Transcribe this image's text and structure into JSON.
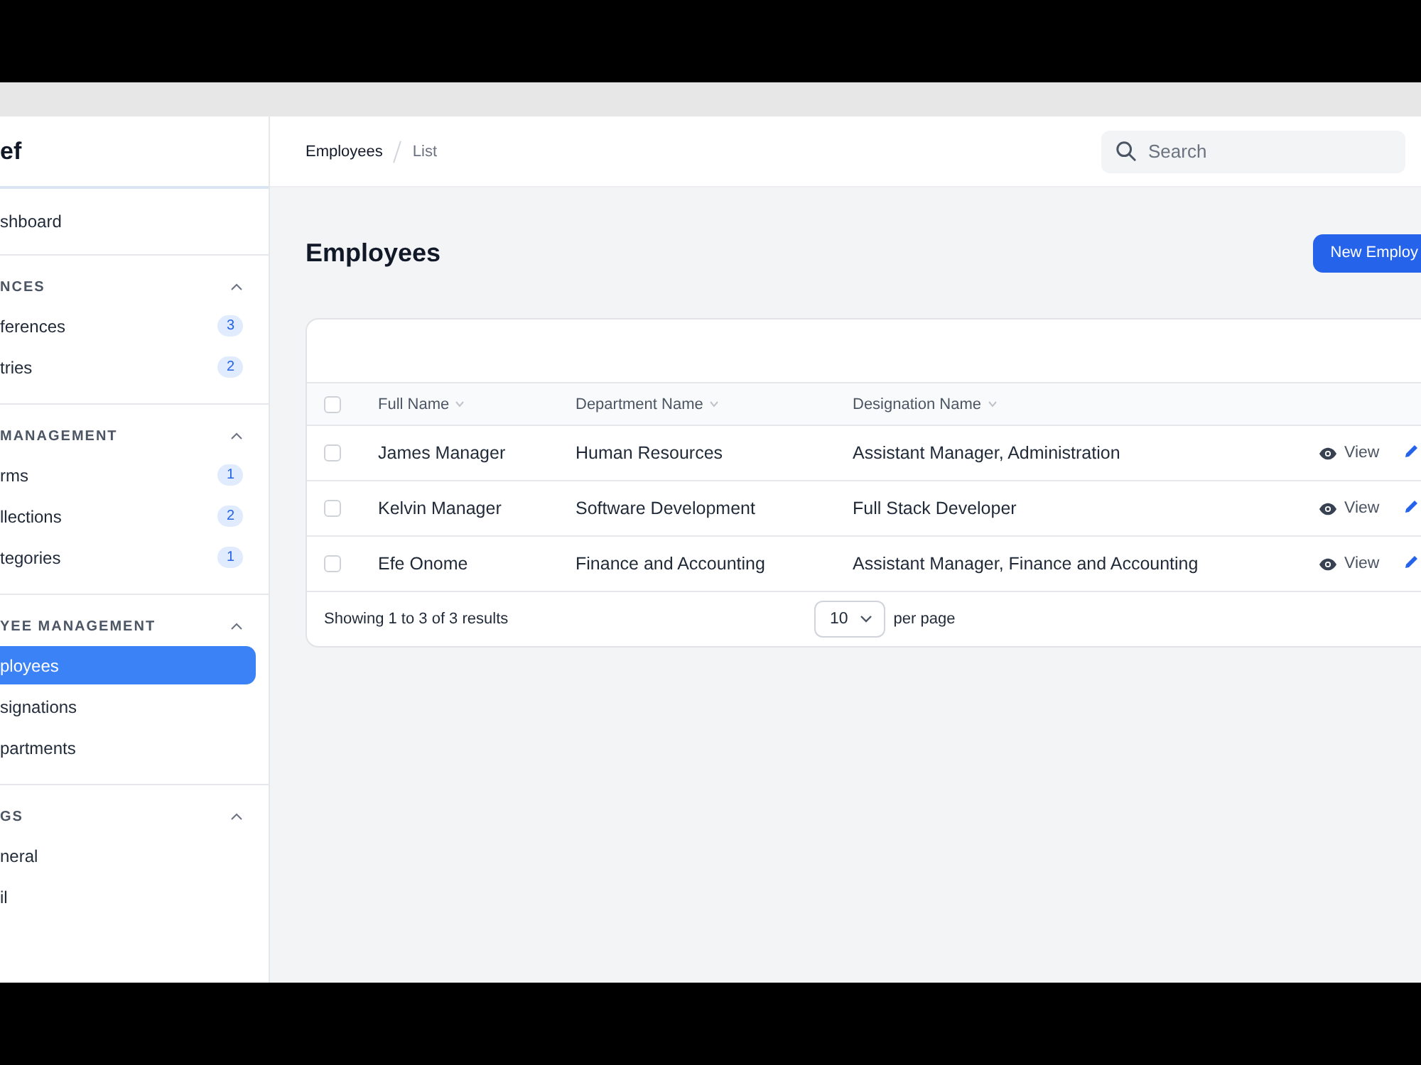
{
  "sidebar": {
    "brand": "ef",
    "top_items": [
      {
        "label": "shboard",
        "selected": false
      }
    ],
    "groups": [
      {
        "title": "NCES",
        "expanded": true,
        "items": [
          {
            "label": "ferences",
            "badge": "3",
            "selected": false
          },
          {
            "label": "tries",
            "badge": "2",
            "selected": false
          }
        ]
      },
      {
        "title": "MANAGEMENT",
        "expanded": true,
        "items": [
          {
            "label": "rms",
            "badge": "1",
            "selected": false
          },
          {
            "label": "llections",
            "badge": "2",
            "selected": false
          },
          {
            "label": "tegories",
            "badge": "1",
            "selected": false
          }
        ]
      },
      {
        "title": "YEE MANAGEMENT",
        "expanded": true,
        "items": [
          {
            "label": "ployees",
            "selected": true
          },
          {
            "label": "signations",
            "selected": false
          },
          {
            "label": "partments",
            "selected": false
          }
        ]
      },
      {
        "title": "GS",
        "expanded": true,
        "items": [
          {
            "label": "neral",
            "selected": false
          },
          {
            "label": "il",
            "selected": false
          }
        ]
      }
    ]
  },
  "breadcrumbs": [
    "Employees",
    "List"
  ],
  "search": {
    "placeholder": "Search"
  },
  "page": {
    "title": "Employees",
    "new_button": "New Employ"
  },
  "table": {
    "columns": [
      "Full Name",
      "Department Name",
      "Designation Name"
    ],
    "rows": [
      {
        "cells": [
          "James Manager",
          "Human Resources",
          "Assistant Manager, Administration"
        ],
        "checked": false,
        "action": "View"
      },
      {
        "cells": [
          "Kelvin Manager",
          "Software Development",
          "Full Stack Developer"
        ],
        "checked": false,
        "action": "View"
      },
      {
        "cells": [
          "Efe Onome",
          "Finance and Accounting",
          "Assistant Manager, Finance and Accounting"
        ],
        "checked": false,
        "action": "View"
      }
    ],
    "header_checked": false,
    "summary": "Showing 1 to 3 of 3 results",
    "per_page_value": "10",
    "per_page_label": "per page"
  }
}
